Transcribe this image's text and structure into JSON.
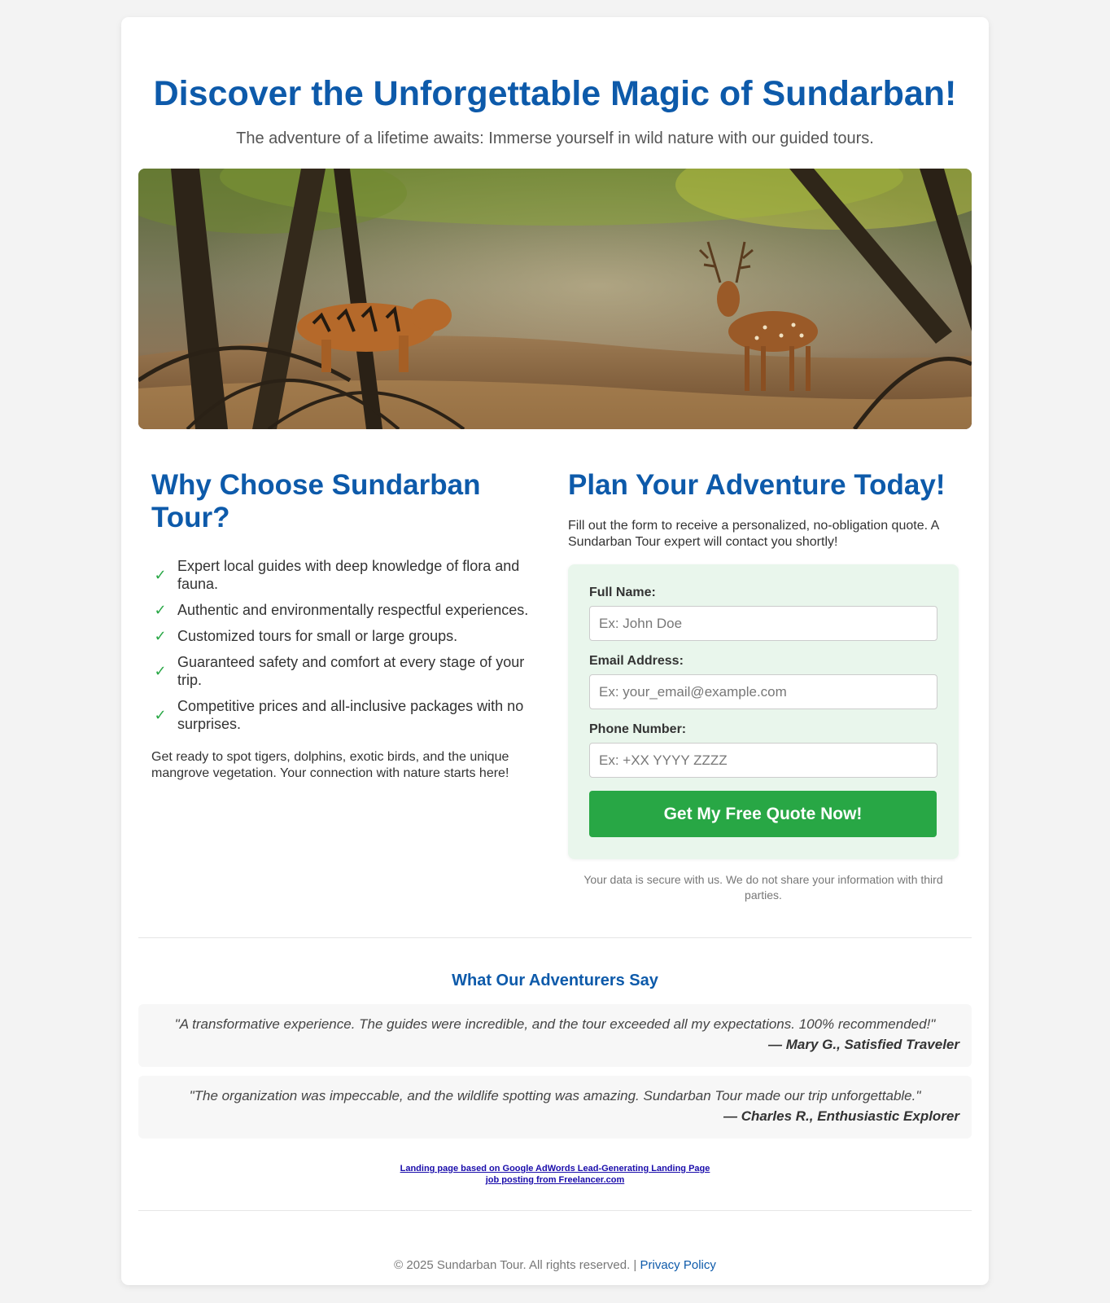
{
  "header": {
    "title": "Discover the Unforgettable Magic of Sundarban!",
    "subtitle": "The adventure of a lifetime awaits: Immerse yourself in wild nature with our guided tours."
  },
  "why": {
    "title": "Why Choose Sundarban Tour?",
    "items": [
      "Expert local guides with deep knowledge of flora and fauna.",
      "Authentic and environmentally respectful experiences.",
      "Customized tours for small or large groups.",
      "Guaranteed safety and comfort at every stage of your trip.",
      "Competitive prices and all-inclusive packages with no surprises."
    ],
    "closing": "Get ready to spot tigers, dolphins, exotic birds, and the unique mangrove vegetation. Your connection with nature starts here!"
  },
  "form": {
    "title": "Plan Your Adventure Today!",
    "intro": "Fill out the form to receive a personalized, no-obligation quote. A Sundarban Tour expert will contact you shortly!",
    "name_label": "Full Name:",
    "name_placeholder": "Ex: John Doe",
    "email_label": "Email Address:",
    "email_placeholder": "Ex: your_email@example.com",
    "phone_label": "Phone Number:",
    "phone_placeholder": "Ex: +XX YYYY ZZZZ",
    "submit_label": "Get My Free Quote Now!",
    "privacy_note": "Your data is secure with us. We do not share your information with third parties."
  },
  "testimonials": {
    "title": "What Our Adventurers Say",
    "items": [
      {
        "quote": "\"A transformative experience. The guides were incredible, and the tour exceeded all my expectations. 100% recommended!\"",
        "author": "— Mary G., Satisfied Traveler"
      },
      {
        "quote": "\"The organization was impeccable, and the wildlife spotting was amazing. Sundarban Tour made our trip unforgettable.\"",
        "author": "— Charles R., Enthusiastic Explorer"
      }
    ]
  },
  "credit": {
    "prefix": "Landing page based on ",
    "link_text": "Google AdWords Lead-Generating Landing Page",
    "line2": "job posting from Freelancer.com"
  },
  "footer": {
    "copyright": "© 2025 Sundarban Tour. All rights reserved. | ",
    "privacy_link": "Privacy Policy"
  },
  "icons": {
    "benefit": "check-icon"
  },
  "colors": {
    "brand_blue": "#0d5aaa",
    "cta_green": "#28a745",
    "form_bg": "#e9f6ec",
    "page_bg": "#f3f3f3"
  }
}
